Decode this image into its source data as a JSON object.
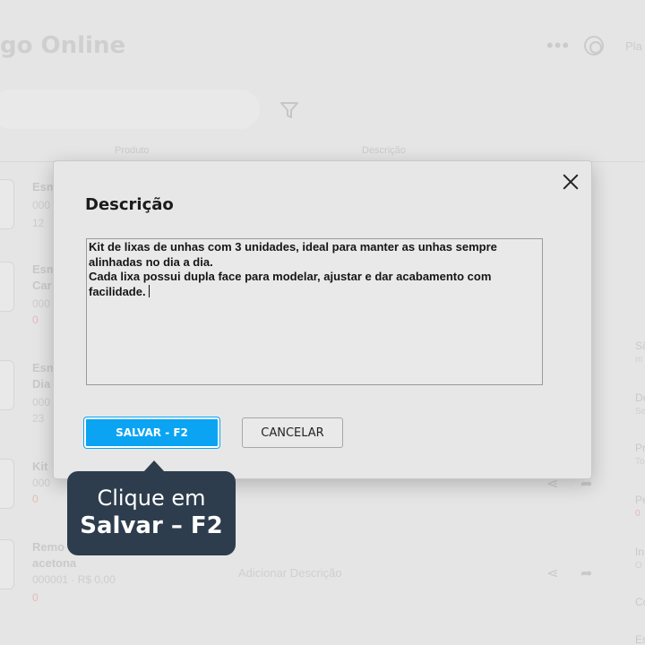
{
  "background": {
    "app_title": "go Online",
    "plan_label": "Pla",
    "columns": [
      "Produto",
      "Descrição"
    ],
    "rows": [
      {
        "name": "Esm",
        "code": "000",
        "extra": "12"
      },
      {
        "name": "Esm\nCar",
        "code": "000",
        "red": "0"
      },
      {
        "name": "Esm\nDia",
        "code": "000",
        "extra": "23"
      },
      {
        "name": "Kit",
        "code": "000",
        "red": "0"
      },
      {
        "name": "Remo\nacetona",
        "code": "000001 · R$ 0,00",
        "red": "0",
        "link": "Adicionar Descrição"
      }
    ],
    "side_items": [
      {
        "title": "Sã",
        "sub": "m"
      },
      {
        "title": "De",
        "sub": "Se"
      },
      {
        "title": "Pr",
        "sub": "To"
      },
      {
        "title": "Pe",
        "sub": "0"
      },
      {
        "title": "In",
        "sub": "O"
      },
      {
        "title": "Co",
        "sub": ""
      },
      {
        "title": "Es",
        "sub": ""
      }
    ]
  },
  "modal": {
    "title": "Descrição",
    "description_value": "Kit de lixas de unhas com 3 unidades, ideal para manter as unhas sempre alinhadas no dia a dia.\nCada lixa possui dupla face para modelar, ajustar e dar acabamento com facilidade.",
    "save_label": "SALVAR - F2",
    "cancel_label": "CANCELAR"
  },
  "tooltip": {
    "line1": "Clique em",
    "line2": "Salvar – F2"
  },
  "colors": {
    "accent": "#0aa4f3",
    "tooltip_bg": "#2e3d4d"
  }
}
